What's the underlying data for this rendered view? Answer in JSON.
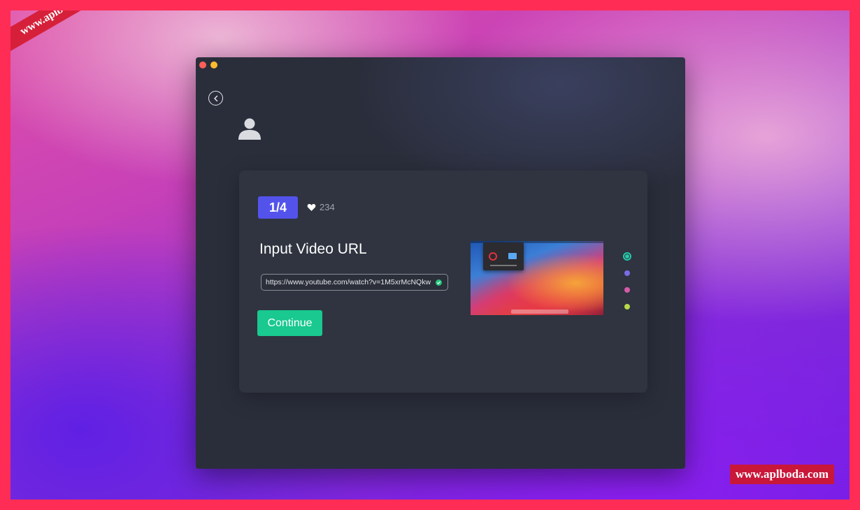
{
  "watermark": {
    "text": "www.aplboda.com"
  },
  "colors": {
    "border": "#ff2d55",
    "step_badge": "#5353ec",
    "continue_button": "#19c98f",
    "pagination_active": "#25c9a9",
    "pagination": [
      "#25c9a9",
      "#7b6be6",
      "#d65aa8",
      "#b8d84a"
    ]
  },
  "window": {
    "icons": {
      "back": "back-arrow-icon",
      "avatar": "user-avatar-icon",
      "like": "heart-icon",
      "valid": "check-icon"
    }
  },
  "card": {
    "step": "1/4",
    "likes": "234",
    "heading": "Input Video URL",
    "url_value": "https://www.youtube.com/watch?v=1M5xrMcNQkw",
    "continue_label": "Continue"
  },
  "pagination": {
    "total": 4,
    "active": 1
  }
}
